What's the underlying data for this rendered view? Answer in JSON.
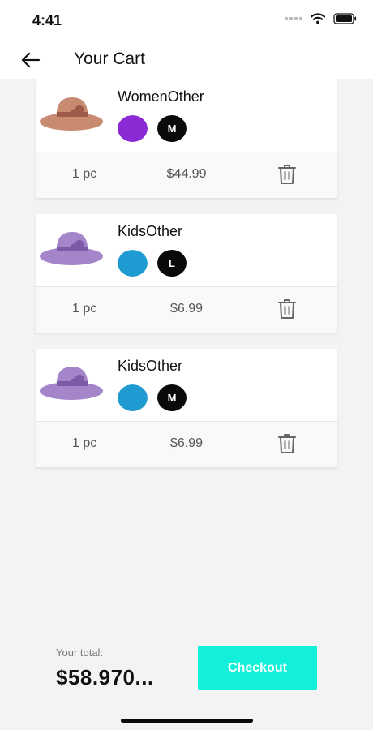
{
  "status_bar": {
    "time": "4:41"
  },
  "header": {
    "title": "Your Cart",
    "back_icon": "arrow-left-icon"
  },
  "cart_items": [
    {
      "name": "WomenOther",
      "color": "#8b2ad4",
      "size": "M",
      "quantity": "1 pc",
      "price": "$44.99",
      "hat_color": "#c98a72",
      "accent_color": "#9d5a48"
    },
    {
      "name": "KidsOther",
      "color": "#1f9bd1",
      "size": "L",
      "quantity": "1 pc",
      "price": "$6.99",
      "hat_color": "#a585c9",
      "accent_color": "#7d5aa8"
    },
    {
      "name": "KidsOther",
      "color": "#1f9bd1",
      "size": "M",
      "quantity": "1 pc",
      "price": "$6.99",
      "hat_color": "#a585c9",
      "accent_color": "#7d5aa8"
    }
  ],
  "footer": {
    "total_label": "Your total:",
    "total_value": "$58.970...",
    "checkout_label": "Checkout",
    "checkout_color": "#12f0da"
  },
  "icons": {
    "delete": "trash-icon",
    "wifi": "wifi-icon",
    "battery": "battery-icon",
    "signal": "signal-icon"
  }
}
